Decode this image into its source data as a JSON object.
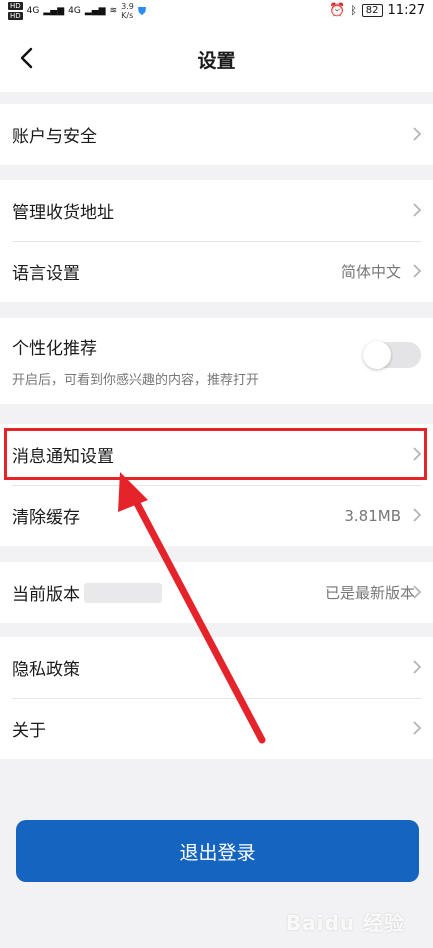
{
  "status_bar": {
    "network_labels": [
      "HD",
      "HD"
    ],
    "signal": [
      "4G",
      "4G"
    ],
    "speed_value": "3.9",
    "speed_unit": "K/s",
    "battery": "82",
    "time": "11:27"
  },
  "header": {
    "title": "设置"
  },
  "sections": [
    {
      "rows": [
        {
          "label": "账户与安全"
        }
      ]
    },
    {
      "rows": [
        {
          "label": "管理收货地址"
        },
        {
          "label": "语言设置",
          "value": "简体中文"
        }
      ]
    },
    {
      "rows": [
        {
          "label": "个性化推荐",
          "sub": "开启后，可看到你感兴趣的内容，推荐打开",
          "toggle_on": false
        }
      ]
    },
    {
      "rows": [
        {
          "label": "消息通知设置"
        },
        {
          "label": "清除缓存",
          "value": "3.81MB"
        }
      ]
    },
    {
      "rows": [
        {
          "label": "当前版本",
          "value": "已是最新版本"
        }
      ]
    },
    {
      "rows": [
        {
          "label": "隐私政策"
        },
        {
          "label": "关于"
        }
      ]
    }
  ],
  "logout_label": "退出登录",
  "watermark": "Baidu 经验",
  "colors": {
    "accent": "#1565c0",
    "annotation": "#e5232b"
  }
}
